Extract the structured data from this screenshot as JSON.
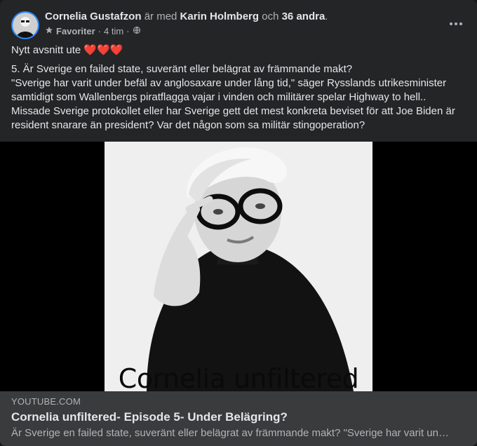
{
  "post": {
    "author": "Cornelia Gustafzon",
    "with_text": "är med",
    "tagged_person": "Karin Holmberg",
    "and_text": "och",
    "others": "36 andra",
    "period": ".",
    "audience": "Favoriter",
    "separator": "·",
    "time": "4 tim",
    "separator2": "·",
    "audience_icon": "globe-icon",
    "more_icon": "more-options-icon",
    "text_intro": "Nytt avsnitt ute",
    "hearts": "❤️❤️❤️",
    "paragraph": [
      "5. Är Sverige en failed state, suveränt eller belägrat av främmande makt?",
      "\"Sverige har varit under befäl av anglosaxare under lång tid,\" säger Rysslands utrikesminister samtidigt som Wallenbergs piratflagga vajar i vinden och militärer spelar Highway to hell..",
      "Missade Sverige protokollet eller har Sverige gett det mest konkreta beviset för att Joe Biden är resident snarare än president? Var det någon som sa militär stingoperation?"
    ]
  },
  "media": {
    "thumbnail_caption": "Cornelia unfiltered"
  },
  "link": {
    "domain": "YOUTUBE.COM",
    "title": "Cornelia unfiltered- Episode 5- Under Belägring?",
    "description": "Är Sverige en failed state, suveränt eller belägrat av främmande makt? \"Sverige har varit under befäl av anglosaxare under lång tid,\" säger Rysslands utrikesminister"
  }
}
